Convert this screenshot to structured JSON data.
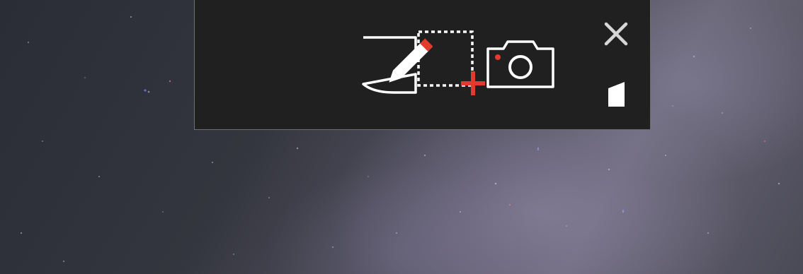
{
  "window": {
    "title": "",
    "tools": [
      {
        "id": "new-snip",
        "icon": "rectangle-snip-plus-icon",
        "label": ""
      },
      {
        "id": "sketch",
        "icon": "sketch-pen-icon",
        "label": ""
      },
      {
        "id": "screenshot",
        "icon": "camera-icon",
        "label": ""
      }
    ],
    "close_icon": "close-icon",
    "snap_icon": "window-snap-icon"
  },
  "colors": {
    "toolbar_bg": "#202020",
    "toolbar_border": "#6e6e6e",
    "icon_white": "#ffffff",
    "accent_red": "#e23a2c"
  }
}
